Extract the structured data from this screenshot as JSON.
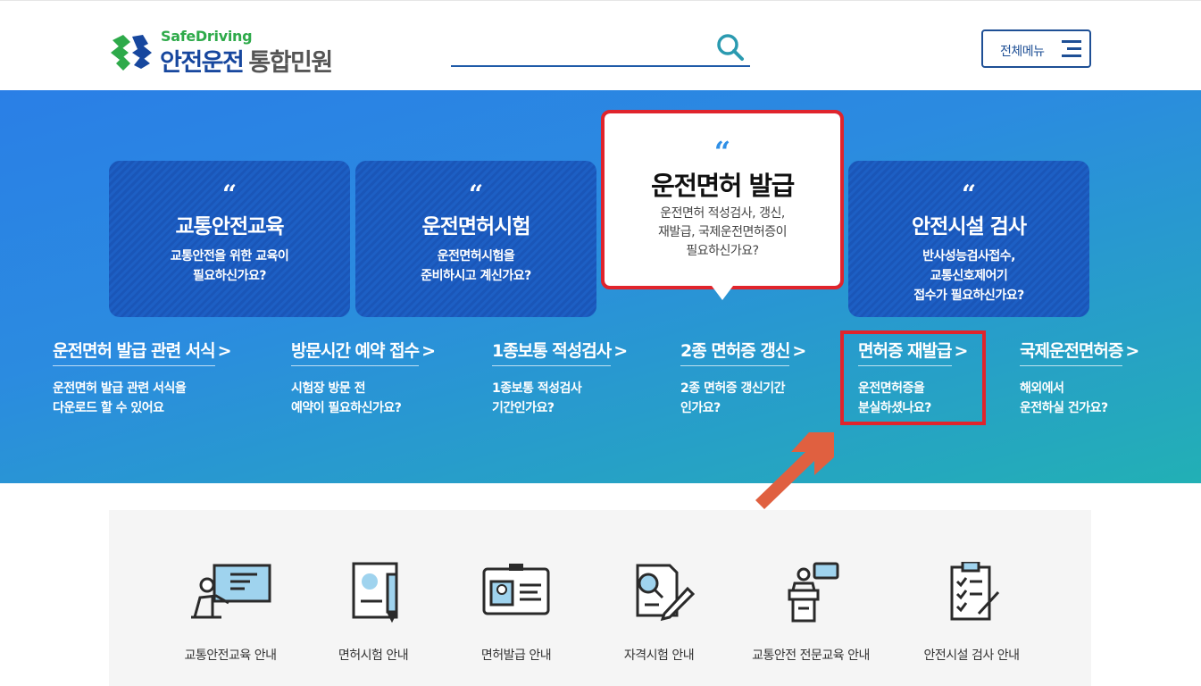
{
  "header": {
    "logo_sub": "SafeDriving",
    "logo_main": "안전운전",
    "logo_main_gray": "통합민원",
    "menu_label": "전체메뉴"
  },
  "cards": [
    {
      "title": "교통안전교육",
      "desc1": "교통안전을 위한 교육이",
      "desc2": "필요하신가요?",
      "desc3": ""
    },
    {
      "title": "운전면허시험",
      "desc1": "운전면허시험을",
      "desc2": "준비하시고 계신가요?",
      "desc3": ""
    },
    {
      "title": "운전면허 발급",
      "desc1": "운전면허 적성검사, 갱신,",
      "desc2": "재발급, 국제운전면허증이",
      "desc3": "필요하신가요?"
    },
    {
      "title": "안전시설 검사",
      "desc1": "반사성능검사접수,",
      "desc2": "교통신호제어기",
      "desc3": "접수가 필요하신가요?"
    }
  ],
  "quote_mark": "“",
  "links": [
    {
      "title": "운전면허 발급 관련 서식",
      "d1": "운전면허 발급 관련 서식을",
      "d2": "다운로드 할 수 있어요"
    },
    {
      "title": "방문시간 예약 접수",
      "d1": "시험장 방문 전",
      "d2": "예약이 필요하신가요?"
    },
    {
      "title": "1종보통 적성검사",
      "d1": "1종보통 적성검사",
      "d2": "기간인가요?"
    },
    {
      "title": "2종 면허증 갱신",
      "d1": "2종 면허증 갱신기간",
      "d2": "인가요?"
    },
    {
      "title": "면허증 재발급",
      "d1": "운전면허증을",
      "d2": "분실하셨나요?"
    },
    {
      "title": "국제운전면허증",
      "d1": "해외에서",
      "d2": "운전하실 건가요?"
    }
  ],
  "link_arrow": ">",
  "services": [
    {
      "label": "교통안전교육 안내",
      "icon": "lecture-icon"
    },
    {
      "label": "면허시험 안내",
      "icon": "exam-document-icon"
    },
    {
      "label": "면허발급 안내",
      "icon": "id-card-icon"
    },
    {
      "label": "자격시험 안내",
      "icon": "qualification-exam-icon"
    },
    {
      "label": "교통안전 전문교육 안내",
      "icon": "speaker-podium-icon"
    },
    {
      "label": "안전시설 검사 안내",
      "icon": "checklist-clipboard-icon"
    }
  ],
  "colors": {
    "brand_blue": "#17479e",
    "brand_green": "#2eaa4a",
    "highlight_red": "#e0242c",
    "arrow_orange": "#e06040"
  }
}
